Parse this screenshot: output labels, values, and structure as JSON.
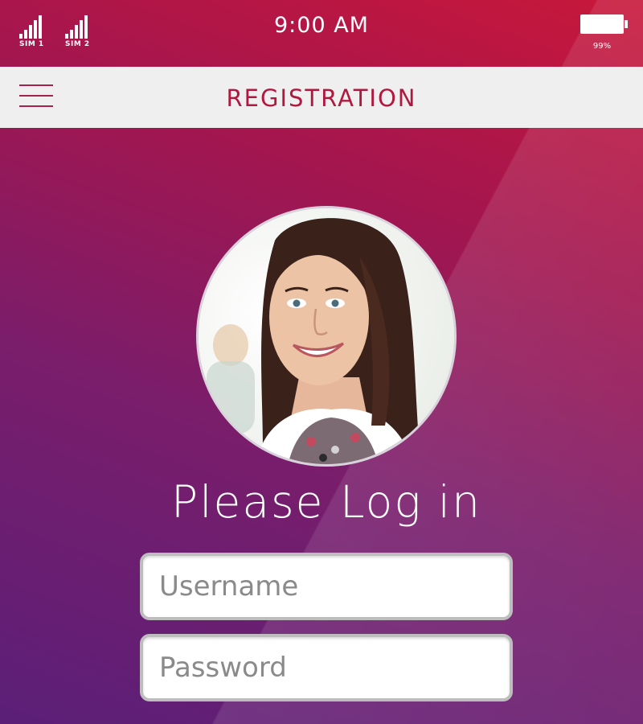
{
  "status_bar": {
    "sim1_label": "SIM 1",
    "sim2_label": "SIM 2",
    "time": "9:00 AM",
    "battery_percent": "99%"
  },
  "header": {
    "title": "REGISTRATION",
    "menu_icon": "hamburger-menu-icon"
  },
  "login": {
    "title": "Please Log in",
    "username_placeholder": "Username",
    "password_placeholder": "Password"
  },
  "colors": {
    "accent": "#b0183f",
    "header_bg": "#efefef",
    "gradient_top": "#c8173a",
    "gradient_bottom": "#5b1f78"
  }
}
